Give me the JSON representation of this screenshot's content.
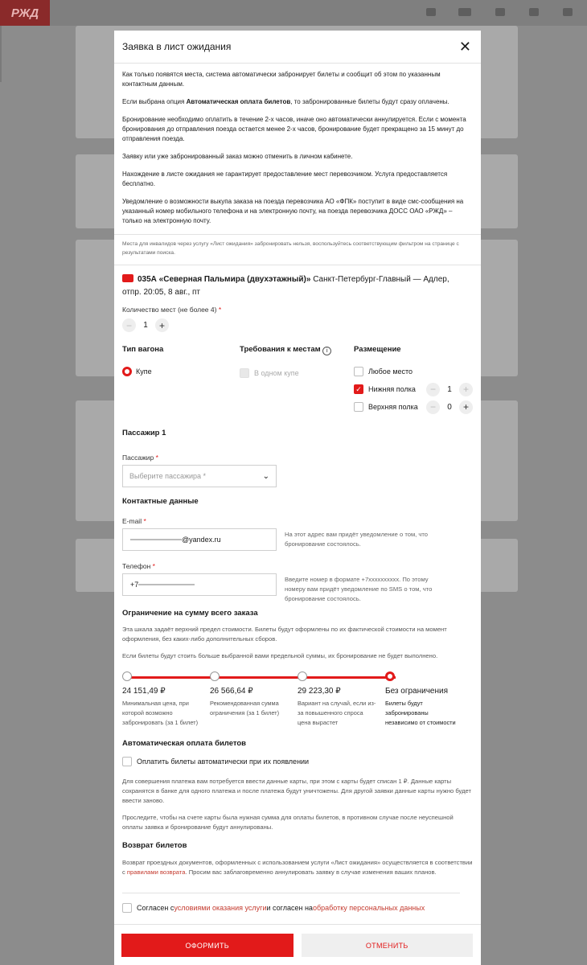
{
  "logo": "РЖД",
  "modal": {
    "title": "Заявка в лист ожидания",
    "info": [
      {
        "text": "Как только появятся места, система автоматически забронирует билеты и сообщит об этом по указанным контактным данным."
      },
      {
        "pre": "Если выбрана опция ",
        "bold": "Автоматическая оплата билетов",
        "post": ", то забронированные билеты будут сразу оплачены."
      },
      {
        "text": "Бронирование необходимо оплатить в течение 2-х часов, иначе оно автоматически аннулируется. Если с момента бронирования до отправления поезда остается менее 2-х часов, бронирование будет прекращено за 15 минут до отправления поезда."
      },
      {
        "text": "Заявку или уже забронированный заказ можно отменить в личном кабинете."
      },
      {
        "text": "Нахождение в листе ожидания не гарантирует предоставление мест перевозчиком. Услуга предоставляется бесплатно."
      },
      {
        "text": "Уведомление о возможности выкупа заказа на поезда перевозчика АО «ФПК» поступит в виде смс-сообщения на указанный номер мобильного телефона и на электронную почту, на поезда перевозчика ДОСС ОАО «РЖД» – только на электронную почту."
      }
    ],
    "note": "Места для инвалидов через услугу «Лист ожидания» забронировать нельзя, воспользуйтесь соответствующим фильтром на странице с результатами поиска.",
    "train": {
      "number_name": "035А «Северная Пальмира (двухэтажный)»",
      "route": "Санкт-Петербург-Главный — Адлер,",
      "departure": "отпр. 20:05, 8 авг., пт"
    },
    "seats": {
      "label": "Количество мест (не более 4)",
      "value": "1"
    },
    "car_type": {
      "title": "Тип вагона",
      "option": "Купе"
    },
    "requirements": {
      "title": "Требования к местам",
      "option": "В одном купе"
    },
    "placement": {
      "title": "Размещение",
      "any": "Любое место",
      "lower": {
        "label": "Нижняя полка",
        "value": "1"
      },
      "upper": {
        "label": "Верхняя полка",
        "value": "0"
      }
    },
    "passenger": {
      "title": "Пассажир 1",
      "label": "Пассажир",
      "placeholder": "Выберите пассажира *"
    },
    "contacts": {
      "title": "Контактные данные",
      "email_label": "E-mail",
      "email_value": "@yandex.ru",
      "email_hint": "На этот адрес вам придёт уведомление о том, что бронирование состоялось.",
      "phone_label": "Телефон",
      "phone_value": "+7",
      "phone_hint": "Введите номер в формате +7xxxxxxxxxx. По этому номеру вам придёт уведомление по SMS о том, что бронирование состоялось."
    },
    "limit": {
      "title": "Ограничение на сумму всего заказа",
      "p1": "Эта шкала задаёт верхний предел стоимости. Билеты будут оформлены по их фактической стоимости на момент оформления, без каких-либо дополнительных сборов.",
      "p2": "Если билеты будут стоить больше выбранной вами предельной суммы, их бронирование не будет выполнено.",
      "options": [
        {
          "price": "24 151,49 ₽",
          "desc": "Минимальная цена, при которой возможно забронировать (за 1 билет)"
        },
        {
          "price": "26 566,64 ₽",
          "desc": "Рекомендованная сумма ограничения (за 1 билет)"
        },
        {
          "price": "29 223,30 ₽",
          "desc": "Вариант на случай, если из-за повышенного спроса цена вырастет"
        },
        {
          "price": "Без ограничения",
          "desc": "Билеты будут забронированы независимо от стоимости"
        }
      ],
      "selected_index": 3
    },
    "autopay": {
      "title": "Автоматическая оплата билетов",
      "checkbox": "Оплатить билеты автоматически при их появлении",
      "p1": "Для совершения платежа вам потребуется ввести данные карты, при этом с карты будет списан 1 ₽. Данные карты сохранятся в банке для одного платежа и после платежа будут уничтожены. Для другой заявки данные карты нужно будет ввести заново.",
      "p2": "Проследите, чтобы на счете карты была нужная сумма для оплаты билетов, в противном случае после неуспешной оплаты заявка и бронирование будут аннулированы."
    },
    "refund": {
      "title": "Возврат билетов",
      "pre": "Возврат проездных документов, оформленных с использованием услуги «Лист ожидания» осуществляется в соответствии с ",
      "link": "правилами возврата",
      "post": ". Просим вас заблаговременно аннулировать заявку в случае изменения ваших планов."
    },
    "agree": {
      "pre": "Согласен с ",
      "link1": "условиями оказания услуги",
      "mid": " и согласен на ",
      "link2": "обработку персональных данных"
    },
    "buttons": {
      "submit": "ОФОРМИТЬ",
      "cancel": "ОТМЕНИТЬ"
    }
  }
}
